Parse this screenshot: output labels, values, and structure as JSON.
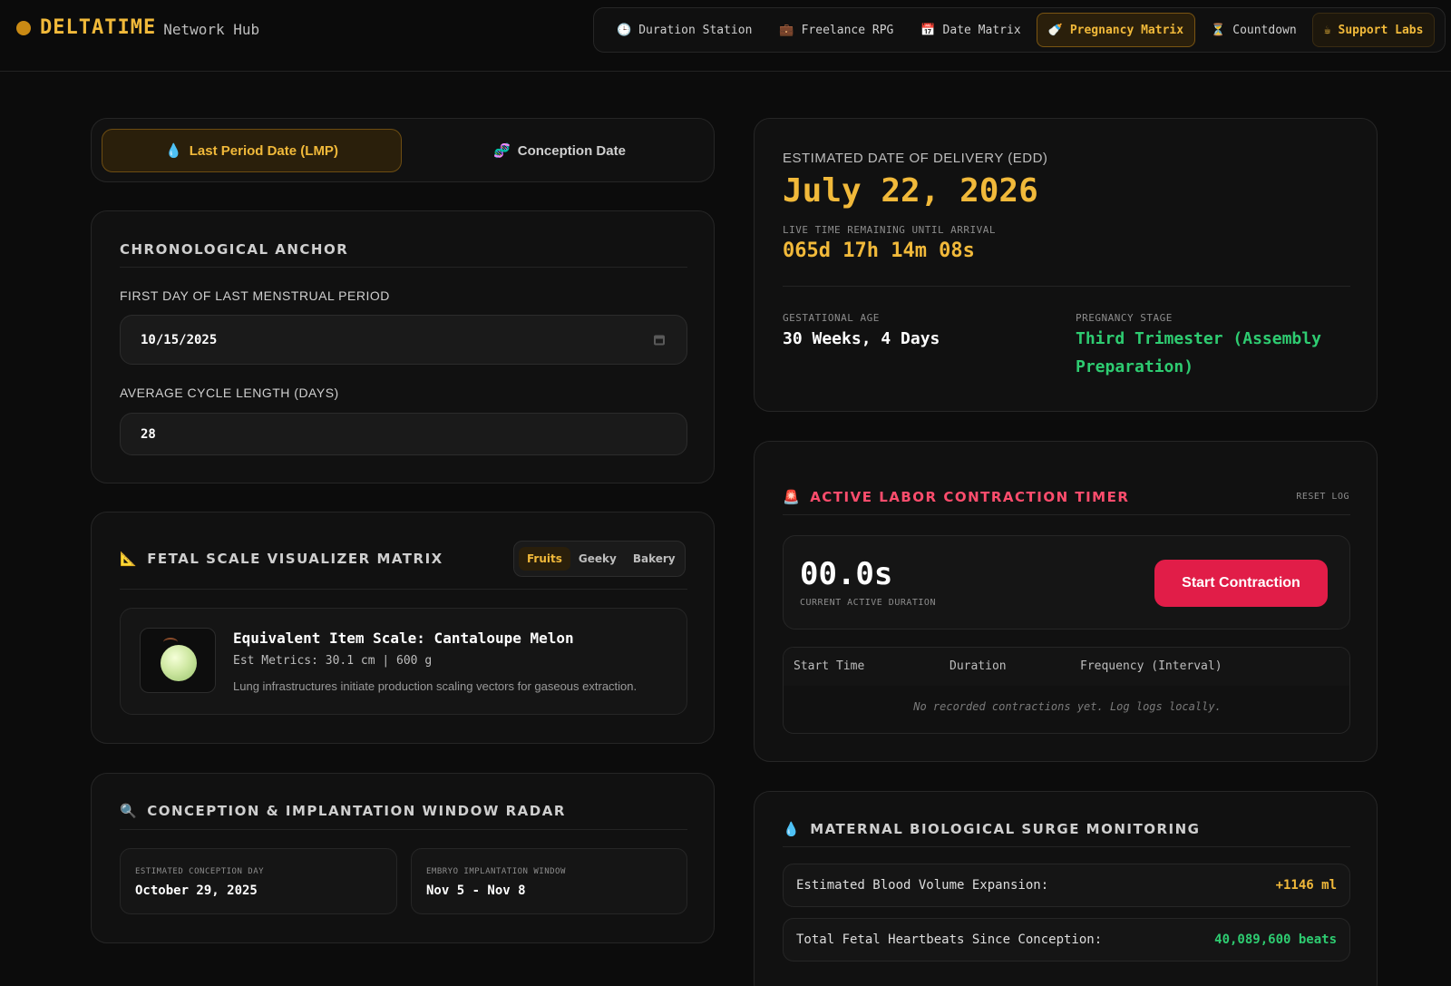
{
  "brand": {
    "name": "DELTATIME",
    "sub": "Network Hub"
  },
  "nav": [
    {
      "icon": "🕒",
      "label": "Duration Station"
    },
    {
      "icon": "💼",
      "label": "Freelance RPG"
    },
    {
      "icon": "📅",
      "label": "Date Matrix"
    },
    {
      "icon": "🍼",
      "label": "Pregnancy Matrix",
      "active": true
    },
    {
      "icon": "⏳",
      "label": "Countdown"
    },
    {
      "icon": "☕",
      "label": "Support Labs"
    }
  ],
  "tabs": {
    "lmp": {
      "icon": "💧",
      "label": "Last Period Date (LMP)"
    },
    "conception": {
      "icon": "🧬",
      "label": "Conception Date"
    }
  },
  "anchor": {
    "title": "CHRONOLOGICAL ANCHOR",
    "lmp_label": "FIRST DAY OF LAST MENSTRUAL PERIOD",
    "lmp_value": "10/15/2025",
    "cycle_label": "AVERAGE CYCLE LENGTH (DAYS)",
    "cycle_value": "28"
  },
  "fetal": {
    "icon": "📐",
    "title": "FETAL SCALE VISUALIZER MATRIX",
    "modes": [
      "Fruits",
      "Geeky",
      "Bakery"
    ],
    "active_mode": "Fruits",
    "item_title": "Equivalent Item Scale: Cantaloupe Melon",
    "metrics": "Est Metrics: 30.1 cm | 600 g",
    "description": "Lung infrastructures initiate production scaling vectors for gaseous extraction."
  },
  "conception": {
    "icon": "🔍",
    "title": "CONCEPTION & IMPLANTATION WINDOW RADAR",
    "day_label": "ESTIMATED CONCEPTION DAY",
    "day_value": "October 29, 2025",
    "window_label": "EMBRYO IMPLANTATION WINDOW",
    "window_value": "Nov 5 - Nov 8"
  },
  "edd": {
    "label": "ESTIMATED DATE OF DELIVERY (EDD)",
    "date": "July 22, 2026",
    "live_label": "LIVE TIME REMAINING UNTIL ARRIVAL",
    "live_value": "065d 17h 14m 08s",
    "ga_label": "GESTATIONAL AGE",
    "ga_value": "30 Weeks, 4 Days",
    "stage_label": "PREGNANCY STAGE",
    "stage_value": "Third Trimester (Assembly Preparation)"
  },
  "labor": {
    "icon": "🚨",
    "title": "ACTIVE LABOR CONTRACTION TIMER",
    "reset": "RESET LOG",
    "timer": "00.0s",
    "timer_sub": "CURRENT ACTIVE DURATION",
    "start_button": "Start Contraction",
    "columns": [
      "Start Time",
      "Duration",
      "Frequency (Interval)"
    ],
    "empty": "No recorded contractions yet. Log logs locally."
  },
  "maternal": {
    "icon": "💧",
    "title": "MATERNAL BIOLOGICAL SURGE MONITORING",
    "blood_label": "Estimated Blood Volume Expansion:",
    "blood_value": "+1146 ml",
    "heart_label": "Total Fetal Heartbeats Since Conception:",
    "heart_value": "40,089,600 beats"
  },
  "colors": {
    "accent": "#f1b93a",
    "green": "#2ecc71",
    "red": "#ff4d6d",
    "button": "#e11d48"
  }
}
